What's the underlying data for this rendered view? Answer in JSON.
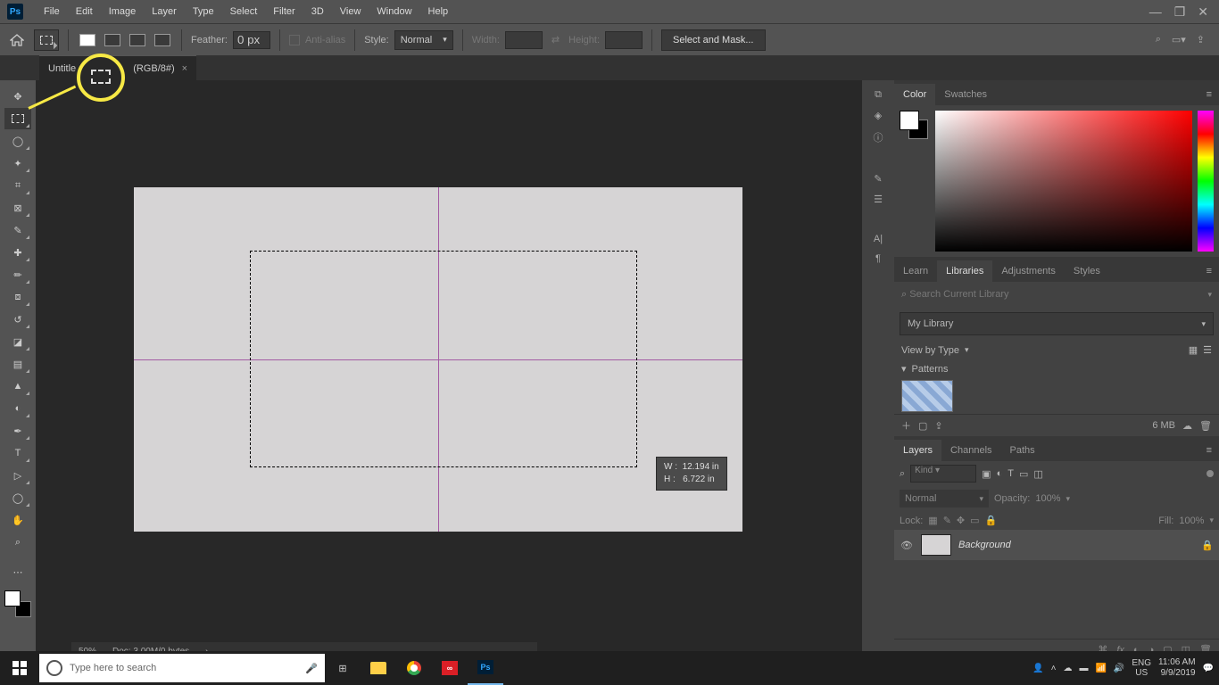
{
  "menu": {
    "items": [
      "File",
      "Edit",
      "Image",
      "Layer",
      "Type",
      "Select",
      "Filter",
      "3D",
      "View",
      "Window",
      "Help"
    ]
  },
  "options": {
    "feather_label": "Feather:",
    "feather_value": "0 px",
    "antialias": "Anti-alias",
    "style_label": "Style:",
    "style_value": "Normal",
    "width_label": "Width:",
    "height_label": "Height:",
    "select_mask": "Select and Mask..."
  },
  "doc": {
    "tab_title": "Untitled-1 @ 50% (RGB/8#)",
    "tab_short": "Untitle",
    "tab_suffix": "(RGB/8#)"
  },
  "tooltip": {
    "w_label": "W :",
    "w_val": "12.194 in",
    "h_label": "H :",
    "h_val": "6.722 in"
  },
  "right": {
    "color_tab": "Color",
    "swatches_tab": "Swatches",
    "learn": "Learn",
    "libraries": "Libraries",
    "adjust": "Adjustments",
    "styles": "Styles",
    "search_ph": "Search Current Library",
    "my_library": "My Library",
    "view_by": "View by Type",
    "patterns": "Patterns",
    "size": "6 MB",
    "layers_tab": "Layers",
    "channels_tab": "Channels",
    "paths_tab": "Paths",
    "kind": "Kind",
    "normal": "Normal",
    "opacity_label": "Opacity:",
    "opacity_val": "100%",
    "lock_label": "Lock:",
    "fill_label": "Fill:",
    "fill_val": "100%",
    "bg_layer": "Background"
  },
  "status": {
    "zoom": "50%",
    "doc": "Doc: 3.00M/0 bytes"
  },
  "taskbar": {
    "search_ph": "Type here to search",
    "lang1": "ENG",
    "lang2": "US",
    "time": "11:06 AM",
    "date": "9/9/2019"
  }
}
